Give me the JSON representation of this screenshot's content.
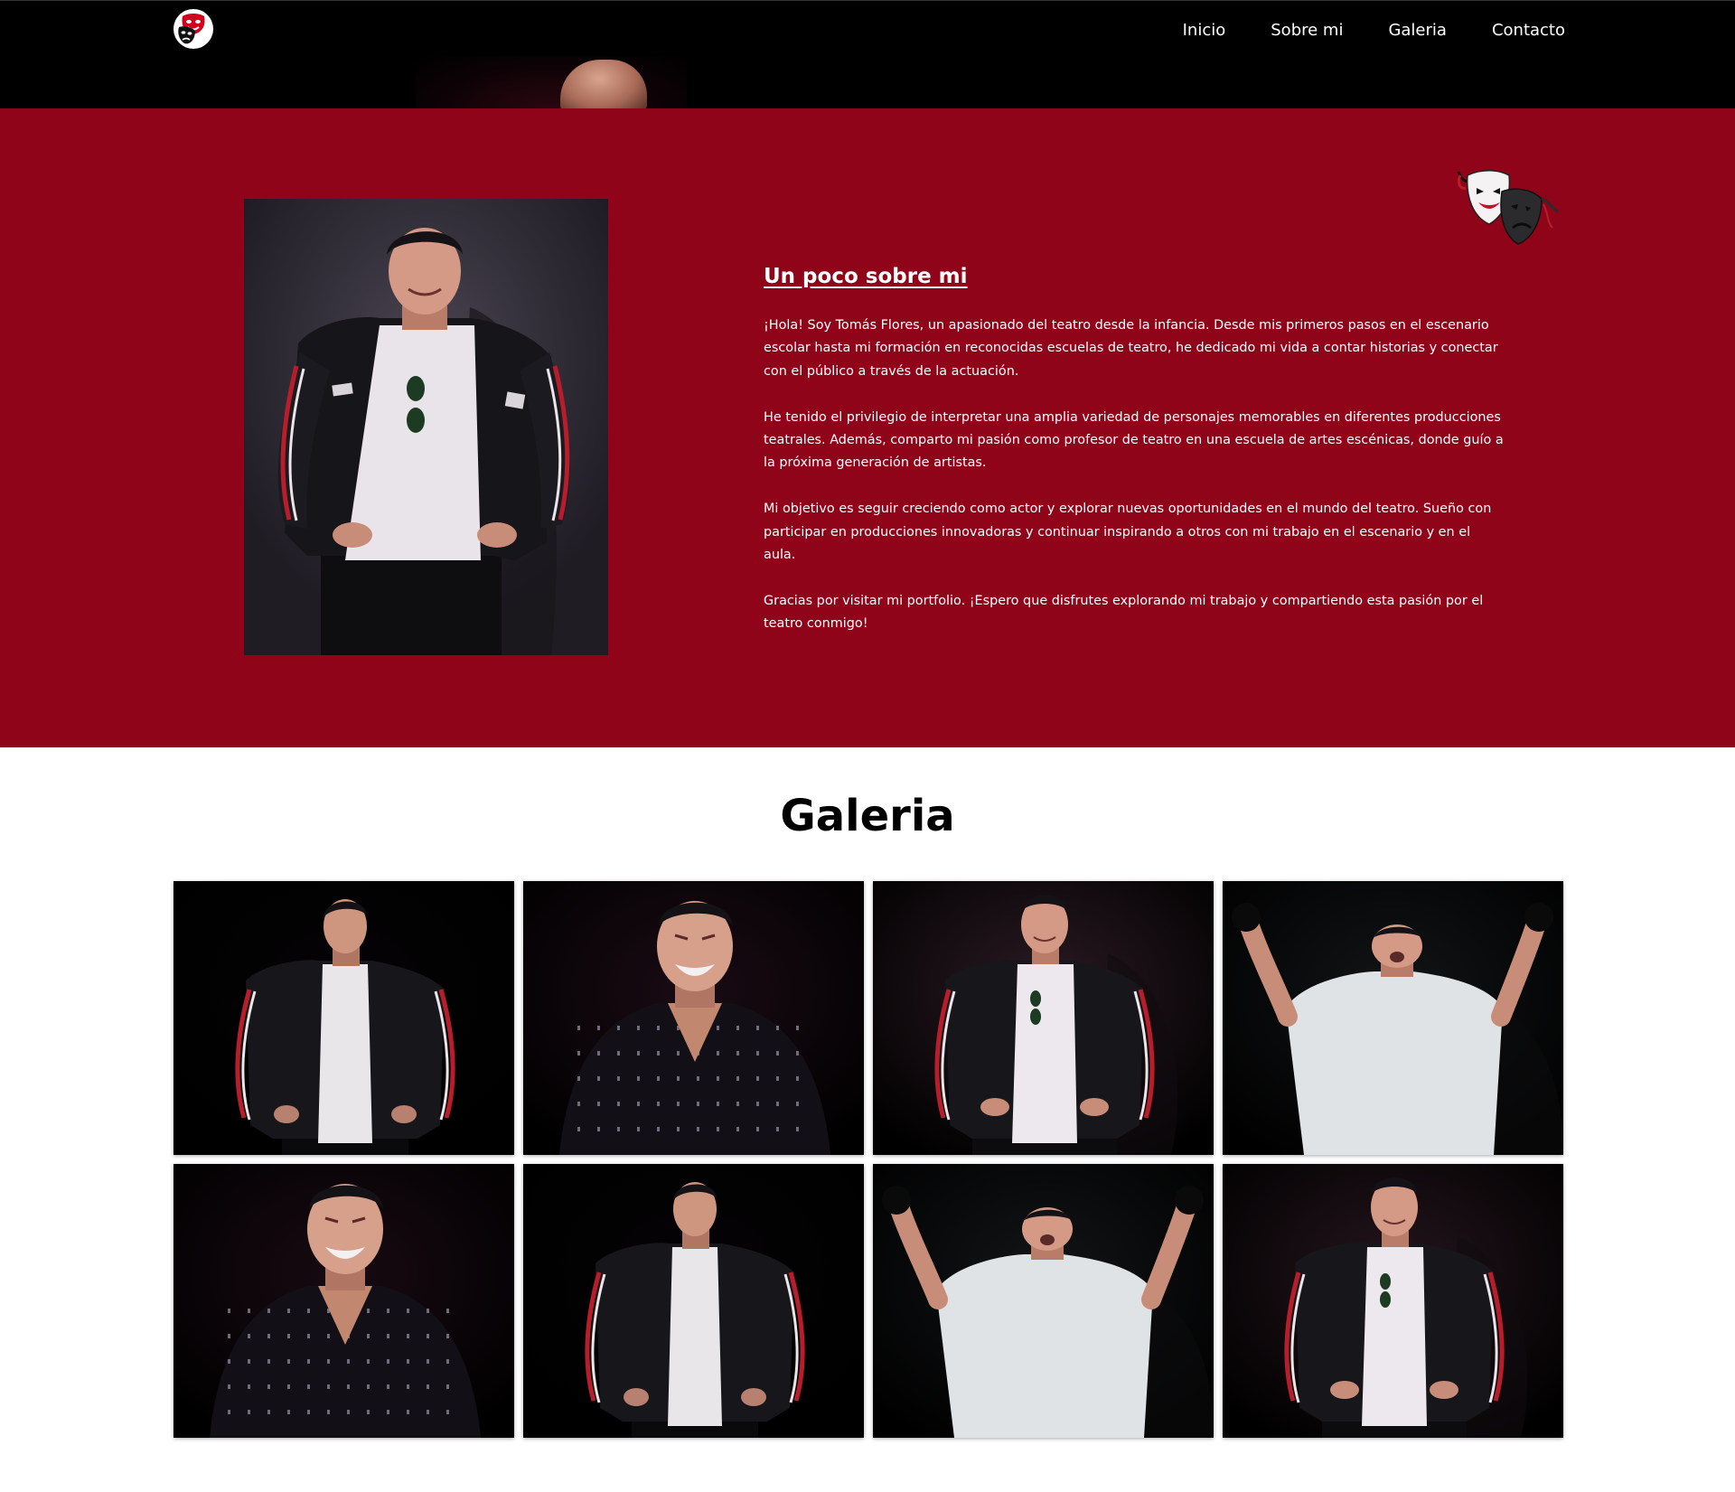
{
  "header": {
    "logo_icon": "theatre-mask-logo-icon",
    "nav": [
      {
        "label": "Inicio"
      },
      {
        "label": "Sobre mi"
      },
      {
        "label": "Galeria"
      },
      {
        "label": "Contacto"
      }
    ]
  },
  "about": {
    "title": "Un poco sobre mi",
    "masks_icon": "comedy-tragedy-masks-icon",
    "paragraphs": [
      "¡Hola! Soy Tomás Flores, un apasionado del teatro desde la infancia. Desde mis primeros pasos en el escenario escolar hasta mi formación en reconocidas escuelas de teatro, he dedicado mi vida a contar historias y conectar con el público a través de la actuación.",
      "He tenido el privilegio de interpretar una amplia variedad de personajes memorables en diferentes producciones teatrales. Además, comparto mi pasión como profesor de teatro en una escuela de artes escénicas, donde guío a la próxima generación de artistas.",
      "Mi objetivo es seguir creciendo como actor y explorar nuevas oportunidades en el mundo del teatro. Sueño con participar en producciones innovadoras y continuar inspirando a otros con mi trabajo en el escenario y en el aula.",
      "Gracias por visitar mi portfolio. ¡Espero que disfrutes explorando mi trabajo y compartiendo esta pasión por el teatro conmigo!"
    ]
  },
  "gallery": {
    "title": "Galeria",
    "photos": [
      {
        "pose": "jacket-looking-side",
        "bg": "#050305"
      },
      {
        "pose": "patterned-shirt-laughing",
        "bg": "#1a0b14"
      },
      {
        "pose": "jacket-smiling",
        "bg": "#2a1a22"
      },
      {
        "pose": "arms-raised-white-tee",
        "bg": "#121416"
      },
      {
        "pose": "patterned-shirt-laughing",
        "bg": "#180a12"
      },
      {
        "pose": "jacket-looking-side",
        "bg": "#050305"
      },
      {
        "pose": "arms-raised-white-tee",
        "bg": "#121416"
      },
      {
        "pose": "jacket-smiling",
        "bg": "#24151c"
      }
    ]
  },
  "colors": {
    "header_bg": "#000000",
    "about_bg": "#8f0419",
    "page_bg": "#ffffff",
    "accent_red": "#c8102e"
  }
}
